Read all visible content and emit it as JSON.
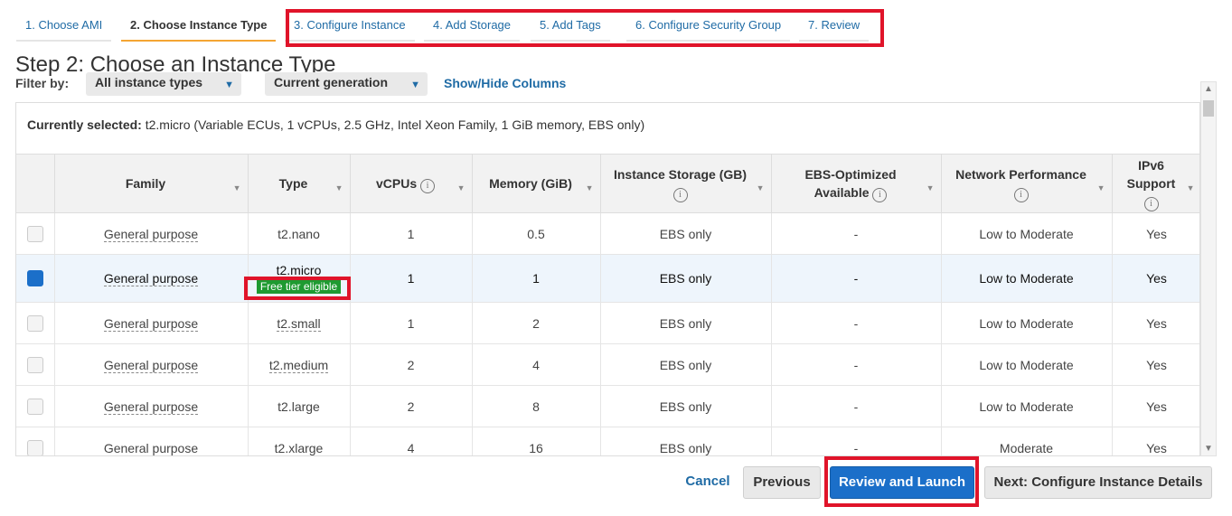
{
  "wizard_tabs": [
    {
      "label": "1. Choose AMI"
    },
    {
      "label": "2. Choose Instance Type"
    },
    {
      "label": "3. Configure Instance"
    },
    {
      "label": "4. Add Storage"
    },
    {
      "label": "5. Add Tags"
    },
    {
      "label": "6. Configure Security Group"
    },
    {
      "label": "7. Review"
    }
  ],
  "page_title": "Step 2: Choose an Instance Type",
  "filter": {
    "label": "Filter by:",
    "instance_types_value": "All instance types",
    "generation_value": "Current generation",
    "show_hide_link": "Show/Hide Columns"
  },
  "currently_selected": {
    "label": "Currently selected:",
    "value": "t2.micro (Variable ECUs, 1 vCPUs, 2.5 GHz, Intel Xeon Family, 1 GiB memory, EBS only)"
  },
  "columns": {
    "family": "Family",
    "type": "Type",
    "vcpus": "vCPUs",
    "memory": "Memory (GiB)",
    "instance_storage": "Instance Storage (GB)",
    "ebs_optimized_line1": "EBS-Optimized",
    "ebs_optimized_line2": "Available",
    "network": "Network Performance",
    "ipv6_line1": "IPv6",
    "ipv6_line2": "Support"
  },
  "rows": [
    {
      "family": "General purpose",
      "type": "t2.nano",
      "vcpus": "1",
      "memory": "0.5",
      "storage": "EBS only",
      "ebs": "-",
      "network": "Low to Moderate",
      "ipv6": "Yes"
    },
    {
      "family": "General purpose",
      "type": "t2.micro",
      "badge": "Free tier eligible",
      "vcpus": "1",
      "memory": "1",
      "storage": "EBS only",
      "ebs": "-",
      "network": "Low to Moderate",
      "ipv6": "Yes"
    },
    {
      "family": "General purpose",
      "type": "t2.small",
      "vcpus": "1",
      "memory": "2",
      "storage": "EBS only",
      "ebs": "-",
      "network": "Low to Moderate",
      "ipv6": "Yes"
    },
    {
      "family": "General purpose",
      "type": "t2.medium",
      "vcpus": "2",
      "memory": "4",
      "storage": "EBS only",
      "ebs": "-",
      "network": "Low to Moderate",
      "ipv6": "Yes"
    },
    {
      "family": "General purpose",
      "type": "t2.large",
      "vcpus": "2",
      "memory": "8",
      "storage": "EBS only",
      "ebs": "-",
      "network": "Low to Moderate",
      "ipv6": "Yes"
    },
    {
      "family": "General purpose",
      "type": "t2.xlarge",
      "vcpus": "4",
      "memory": "16",
      "storage": "EBS only",
      "ebs": "-",
      "network": "Moderate",
      "ipv6": "Yes"
    }
  ],
  "footer": {
    "cancel": "Cancel",
    "previous": "Previous",
    "review_launch": "Review and Launch",
    "next": "Next: Configure Instance Details"
  },
  "colors": {
    "highlight_box": "#e0142a",
    "primary": "#1b6fc9",
    "badge": "#1f9a31",
    "link": "#1f6ba5"
  }
}
